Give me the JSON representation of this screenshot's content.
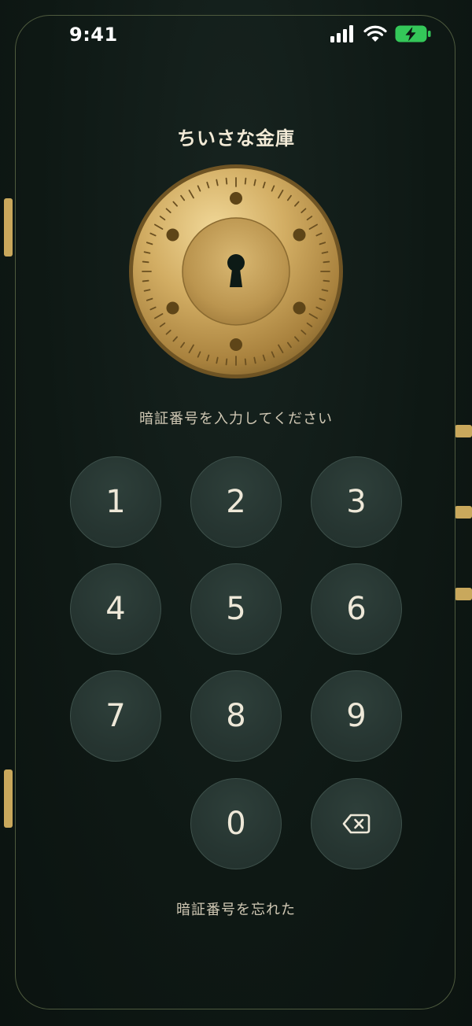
{
  "status_bar": {
    "time": "9:41",
    "icons": [
      "cellular-signal-icon",
      "wifi-icon",
      "battery-charging-icon"
    ],
    "battery_color": "#34c759"
  },
  "title": "ちいさな金庫",
  "safe_dial": {
    "icon": "keyhole-icon",
    "gold_color": "#c9a85c"
  },
  "prompt": "暗証番号を入力してください",
  "keypad": {
    "keys": [
      "1",
      "2",
      "3",
      "4",
      "5",
      "6",
      "7",
      "8",
      "9",
      "0"
    ],
    "delete_icon": "backspace-icon"
  },
  "forgot_link": "暗証番号を忘れた",
  "colors": {
    "background": "#0f1a17",
    "key_fill": "#2a3a35",
    "accent_gold": "#c9a85c",
    "text": "#eee8d8"
  }
}
